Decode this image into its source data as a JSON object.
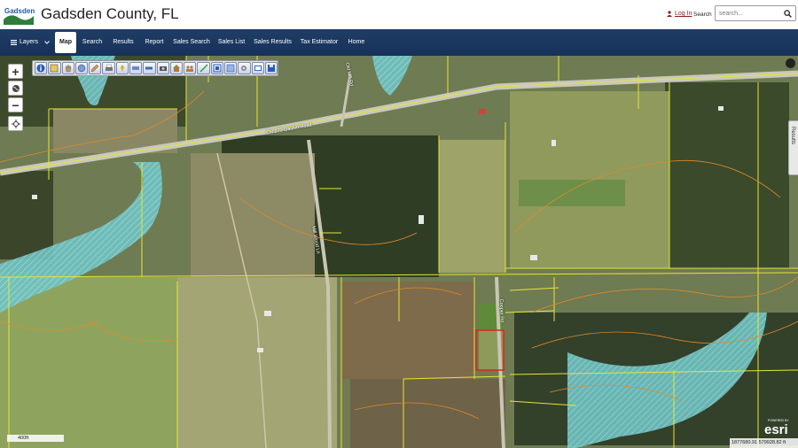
{
  "header": {
    "title": "Gadsden County, FL",
    "login_label": "Log In",
    "search_label": "Search",
    "search_placeholder": "search..."
  },
  "nav": {
    "items": [
      {
        "label": "Layers"
      },
      {
        "label": "Map"
      },
      {
        "label": "Search"
      },
      {
        "label": "Results"
      },
      {
        "label": "Report"
      },
      {
        "label": "Sales Search"
      },
      {
        "label": "Sales List"
      },
      {
        "label": "Sales Results"
      },
      {
        "label": "Tax Estimator"
      },
      {
        "label": "Home"
      }
    ],
    "active": "Map"
  },
  "map": {
    "road_labels": [
      "CR 270 Gaskin Road",
      "Mill Wood Ln",
      "Cooper Rd",
      "Old Mill Rd"
    ],
    "results_tab": "Results",
    "scale_label": "400ft",
    "esri_powered": "POWERED BY",
    "esri_logo": "esri",
    "coordinates": "1877680.91 579928.82 ft"
  },
  "colors": {
    "nav_bg": "#1f3d66",
    "parcel_line": "#e6e632",
    "contour": "#e08a2a",
    "flood_zone": "#78c8c8",
    "selected_parcel": "#e02020"
  }
}
